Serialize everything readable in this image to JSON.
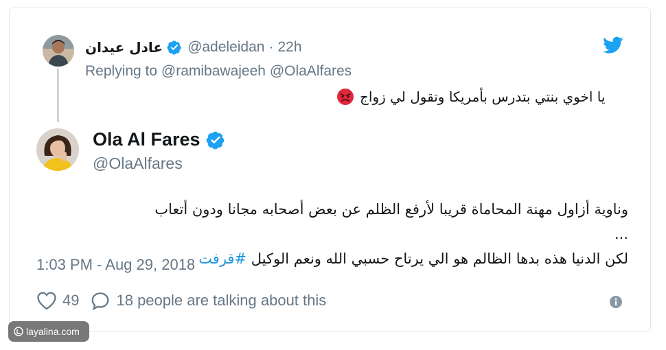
{
  "parent_tweet": {
    "display_name": "عادل عيدان",
    "handle": "@adeleidan",
    "separator": "·",
    "time": "22h",
    "replying_prefix": "Replying to",
    "replying_to": [
      "@ramibawajeeh",
      "@OlaAlfares"
    ],
    "text": "يا اخوي بنتي بتدرس بأمريكا وتقول لي زواج",
    "emoji": "angry-face-emoji"
  },
  "main_tweet": {
    "display_name": "Ola Al Fares",
    "handle": "@OlaAlfares",
    "text_line1": "وناوية أزاول مهنة المحاماة قريبا لأرفع الظلم عن بعض أصحابه مجانا ودون أتعاب ...",
    "text_line2": "لكن الدنيا هذه بدها الظالم هو الي يرتاح حسبي الله ونعم الوكيل",
    "hashtag": "#قرفت",
    "timestamp": "1:03 PM - Aug 29, 2018",
    "likes": "49",
    "talking": "18 people are talking about this"
  },
  "watermark": "layalina.com",
  "colors": {
    "twitter_blue": "#1da1f2",
    "secondary_text": "#657786",
    "link": "#1b95e0",
    "border": "#e1e8ed"
  },
  "icons": [
    "twitter-bird-icon",
    "verified-badge-icon",
    "heart-icon",
    "comment-icon",
    "info-icon"
  ]
}
